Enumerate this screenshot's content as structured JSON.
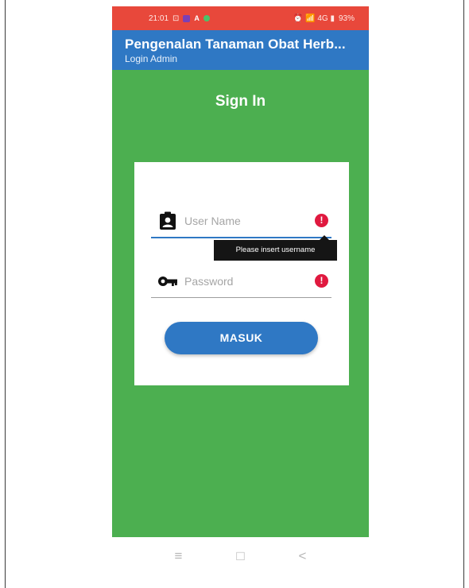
{
  "status_bar": {
    "time": "21:01",
    "left_glyph": "⊡",
    "right_text": "⏰ 📶 4G ▮",
    "battery": "93%"
  },
  "app_bar": {
    "title": "Pengenalan Tanaman Obat Herb...",
    "subtitle": "Login Admin"
  },
  "form": {
    "heading": "Sign In",
    "username": {
      "placeholder": "User Name",
      "value": "",
      "error_icon": "!"
    },
    "password": {
      "placeholder": "Password",
      "value": "",
      "error_icon": "!"
    },
    "error_tooltip": "Please insert username",
    "submit_label": "MASUK"
  },
  "nav_bar": {
    "recents": "≡",
    "home": "□",
    "back": "<"
  },
  "colors": {
    "status_bar": "#e8483b",
    "app_bar": "#2f78c4",
    "background": "#4caf50",
    "button": "#2f78c4",
    "error": "#e0193f"
  },
  "icons": {
    "username_field": "contact-badge-icon",
    "password_field": "key-icon",
    "field_error": "error-icon"
  }
}
